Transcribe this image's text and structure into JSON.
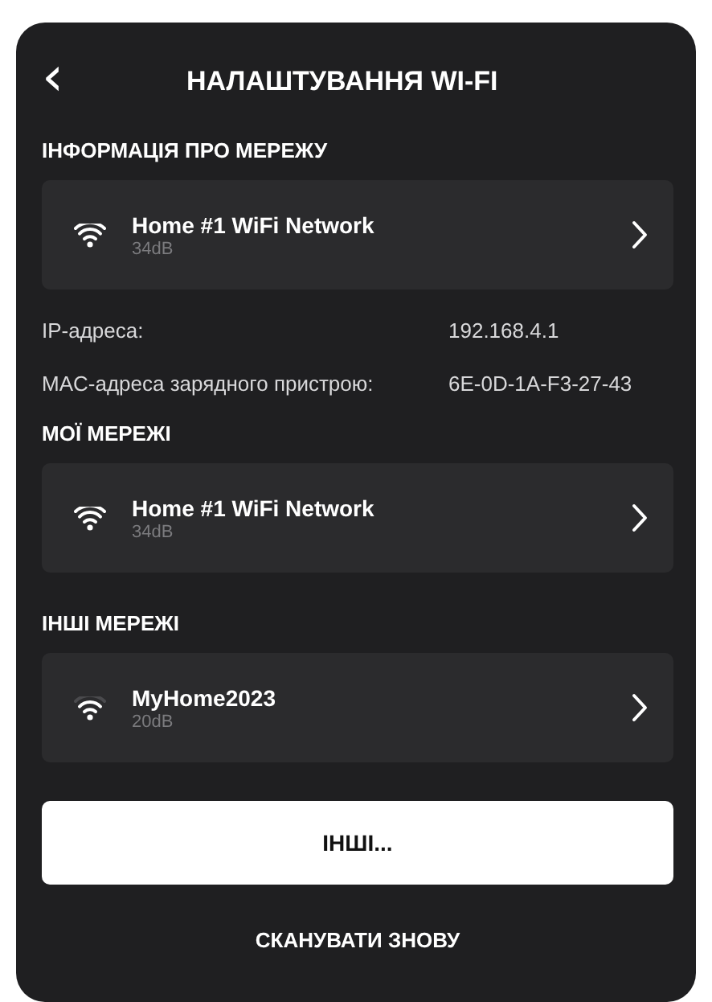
{
  "header": {
    "back_icon": "‹",
    "title": "НАЛАШТУВАННЯ WI-FI"
  },
  "network_info": {
    "heading": "ІНФОРМАЦІЯ ПРО МЕРЕЖУ",
    "current": {
      "name": "Home #1 WiFi Network",
      "strength": "34dB",
      "kind": "strong"
    },
    "details": [
      {
        "label": "IP-адреса:",
        "value": "192.168.4.1"
      },
      {
        "label": "MAC-адреса зарядного пристрою:",
        "value": "6E-0D-1A-F3-27-43"
      }
    ]
  },
  "my_networks": {
    "heading": "МОЇ МЕРЕЖІ",
    "items": [
      {
        "name": "Home #1 WiFi Network",
        "strength": "34dB",
        "kind": "strong"
      }
    ]
  },
  "other_networks": {
    "heading": "ІНШІ МЕРЕЖІ",
    "items": [
      {
        "name": "MyHome2023",
        "strength": "20dB",
        "kind": "weak"
      }
    ]
  },
  "other_button": "ІНШІ...",
  "scan_button": "СКАНУВАТИ ЗНОВУ"
}
